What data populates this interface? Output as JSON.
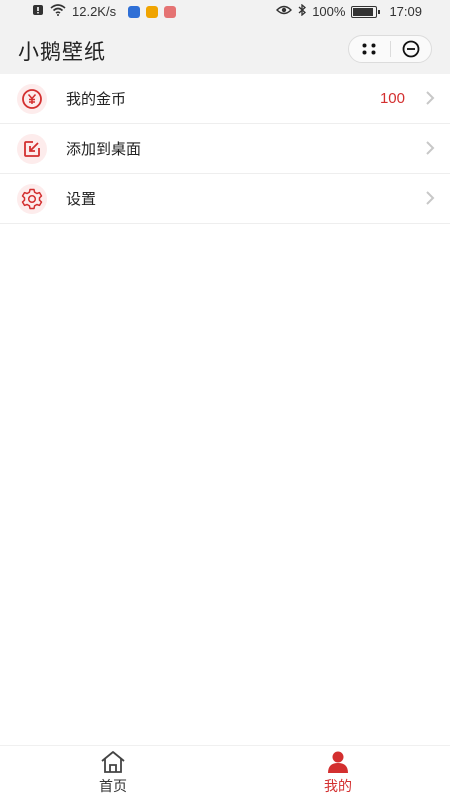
{
  "status_bar": {
    "network_speed": "12.2K/s",
    "battery": "100%",
    "time": "17:09"
  },
  "header": {
    "title": "小鹅壁纸"
  },
  "menu": [
    {
      "label": "我的金币",
      "value": "100",
      "icon": "coin-icon"
    },
    {
      "label": "添加到桌面",
      "value": "",
      "icon": "add-to-desktop-icon"
    },
    {
      "label": "设置",
      "value": "",
      "icon": "settings-gear-icon"
    }
  ],
  "tabbar": {
    "tabs": [
      {
        "label": "首页",
        "icon": "home-icon",
        "active": false
      },
      {
        "label": "我的",
        "icon": "user-icon",
        "active": true
      }
    ],
    "active_color": "#d32f2f",
    "inactive_color": "#333333"
  },
  "colors": {
    "accent": "#d32f2f",
    "icon_bg": "#fdecec",
    "header_bg": "#f2f2f2"
  }
}
